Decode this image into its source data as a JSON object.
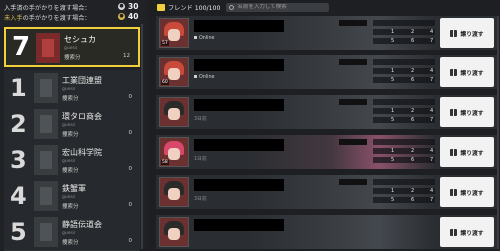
{
  "hints": [
    {
      "label_highlight": "入手済",
      "label_rest": "の手がかりを渡す場合：",
      "value": "30",
      "color": "#e6e6e6"
    },
    {
      "label_highlight": "未入手",
      "label_rest": "の手がかりを渡す場合：",
      "value": "40",
      "color": "#d6b84a"
    }
  ],
  "guilds": [
    {
      "rank": "7",
      "name": "セシュカ",
      "sub": "guess",
      "label": "捜索分",
      "count": "12",
      "selected": true
    },
    {
      "rank": "1",
      "name": "工業団連盟",
      "sub": "guess",
      "label": "捜索分",
      "count": "0"
    },
    {
      "rank": "2",
      "name": "環タロ商会",
      "sub": "guess",
      "label": "捜索分",
      "count": "0"
    },
    {
      "rank": "3",
      "name": "宏山科学院",
      "sub": "guess",
      "label": "捜索分",
      "count": "0"
    },
    {
      "rank": "4",
      "name": "鉄蟹軍",
      "sub": "guess",
      "label": "捜索分",
      "count": "0"
    },
    {
      "rank": "5",
      "name": "静語伝道会",
      "sub": "guess",
      "label": "捜索分",
      "count": "0"
    }
  ],
  "friends_header": {
    "label": "フレンド 100/100",
    "search_placeholder": "名前を入力して検索"
  },
  "friends": [
    {
      "level": "57",
      "status": "Online",
      "online": true,
      "stats": [
        "1",
        "2",
        "4",
        "5",
        "6",
        "7"
      ],
      "button": "譲り渡す",
      "avatar": "red"
    },
    {
      "level": "60",
      "status": "Online",
      "online": true,
      "stats": [
        "1",
        "2",
        "4",
        "5",
        "6",
        "7"
      ],
      "button": "譲り渡す",
      "avatar": "red"
    },
    {
      "level": "",
      "status": "3日前",
      "online": false,
      "stats": [
        "1",
        "2",
        "4",
        "5",
        "6",
        "7"
      ],
      "button": "譲り渡す",
      "avatar": "dark"
    },
    {
      "level": "58",
      "status": "1日前",
      "online": false,
      "stats": [
        "1",
        "2",
        "4",
        "5",
        "6",
        "7"
      ],
      "button": "譲り渡す",
      "avatar": "pink"
    },
    {
      "level": "",
      "status": "3日前",
      "online": false,
      "stats": [
        "1",
        "2",
        "4",
        "5",
        "6",
        "7"
      ],
      "button": "譲り渡す",
      "avatar": "dark"
    },
    {
      "level": "",
      "status": "",
      "online": false,
      "stats": [
        "",
        "",
        "",
        "",
        "",
        ""
      ],
      "button": "譲り渡す",
      "avatar": "dark"
    }
  ]
}
